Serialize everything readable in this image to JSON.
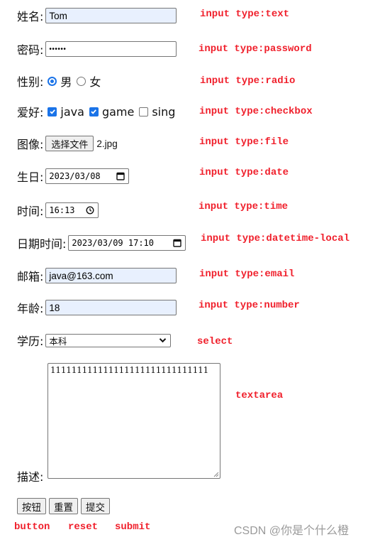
{
  "form": {
    "name": {
      "label": "姓名:",
      "value": "Tom",
      "type_note": "input type:text"
    },
    "password": {
      "label": "密码:",
      "masked_value": "••••••",
      "type_note": "input type:password"
    },
    "gender": {
      "label": "性别:",
      "options": [
        {
          "label": "男",
          "checked": true
        },
        {
          "label": "女",
          "checked": false
        }
      ],
      "type_note": "input type:radio"
    },
    "hobby": {
      "label": "爱好:",
      "options": [
        {
          "label": "java",
          "checked": true
        },
        {
          "label": "game",
          "checked": true
        },
        {
          "label": "sing",
          "checked": false
        }
      ],
      "type_note": "input type:checkbox"
    },
    "image": {
      "label": "图像:",
      "button_label": "选择文件",
      "file_name": "2.jpg",
      "type_note": "input type:file"
    },
    "birthday": {
      "label": "生日:",
      "value": "2023/03/08",
      "icon": "calendar-icon",
      "type_note": "input type:date"
    },
    "time": {
      "label": "时间:",
      "value": "16:13",
      "icon": "clock-icon",
      "type_note": "input type:time"
    },
    "datetime": {
      "label": "日期时间:",
      "value": "2023/03/09 17:10",
      "icon": "calendar-icon",
      "type_note": "input type:datetime-local"
    },
    "email": {
      "label": "邮箱:",
      "value": "java@163.com",
      "type_note": "input type:email"
    },
    "age": {
      "label": "年龄:",
      "value": "18",
      "type_note": "input type:number"
    },
    "education": {
      "label": "学历:",
      "selected": "本科",
      "icon": "chevron-down-icon",
      "type_note": "select"
    },
    "description": {
      "label": "描述:",
      "value": "111111111111111111111111111111",
      "type_note": "textarea"
    },
    "buttons": [
      {
        "label": "按钮",
        "type_note": "button"
      },
      {
        "label": "重置",
        "type_note": "reset"
      },
      {
        "label": "提交",
        "type_note": "submit"
      }
    ]
  },
  "colors": {
    "note_red": "#f0202c",
    "autofill_bg": "#e8f0fe",
    "accent_blue": "#1a73e8"
  },
  "watermark": "CSDN @你是个什么橙"
}
